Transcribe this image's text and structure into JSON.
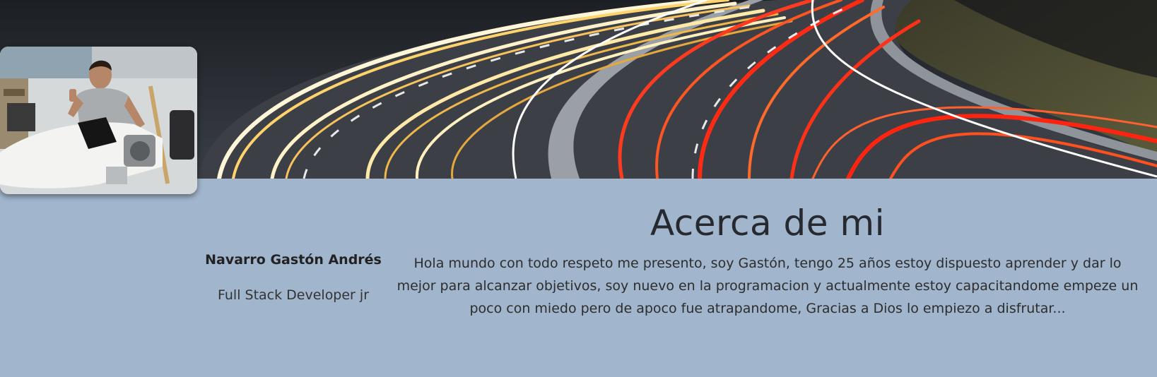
{
  "banner": {
    "image": "night-highway-light-trails"
  },
  "profile": {
    "photo": "profile-photo-person-with-aircraft",
    "name": "Navarro Gastón Andrés",
    "role": "Full Stack Developer jr"
  },
  "about": {
    "heading": "Acerca de mi",
    "text": "Hola mundo con todo respeto me presento, soy Gastón, tengo 25 años estoy dispuesto aprender y dar lo mejor para alcanzar objetivos, soy nuevo en la programacion y actualmente estoy capacitandome empeze un poco con miedo pero de apoco fue atrapandome, Gracias a Dios lo empiezo a disfrutar..."
  }
}
